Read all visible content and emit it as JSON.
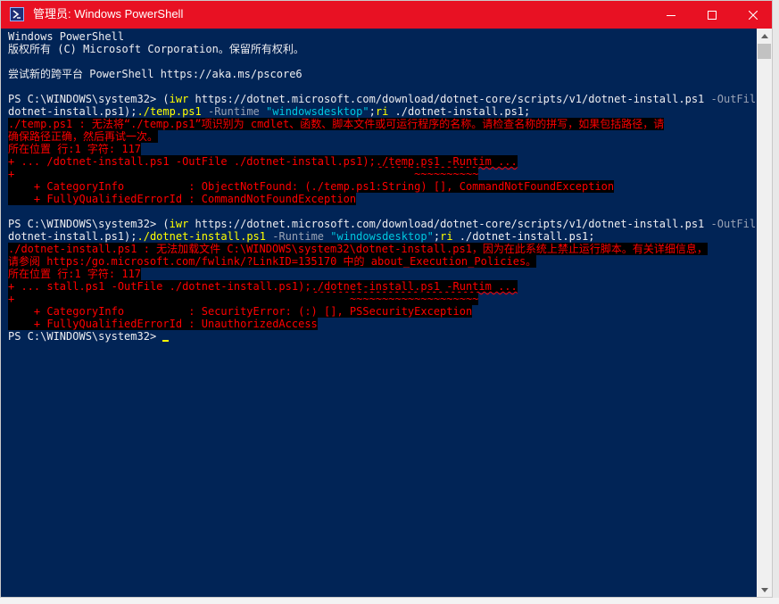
{
  "window": {
    "title": "管理员: Windows PowerShell",
    "title_bar_color": "#e81123",
    "background_color": "#012456",
    "icons": {
      "app": "powershell-icon",
      "minimize": "minimize-icon",
      "maximize": "maximize-icon",
      "close": "close-icon"
    }
  },
  "terminal": {
    "lines": [
      [
        {
          "t": "Windows PowerShell",
          "c": "w"
        }
      ],
      [
        {
          "t": "版权所有 (C) Microsoft Corporation。保留所有权利。",
          "c": "w"
        }
      ],
      [
        {
          "t": "",
          "c": "w"
        }
      ],
      [
        {
          "t": "尝试新的跨平台 PowerShell https://aka.ms/pscore6",
          "c": "w"
        }
      ],
      [
        {
          "t": "",
          "c": "w"
        }
      ],
      [
        {
          "t": "PS C:\\WINDOWS\\system32> ",
          "c": "w"
        },
        {
          "t": "(",
          "c": "w"
        },
        {
          "t": "iwr",
          "c": "y"
        },
        {
          "t": " https://dotnet.microsoft.com/download/dotnet-core/scripts/v1/dotnet-install.ps1 ",
          "c": "w"
        },
        {
          "t": "-OutFile",
          "c": "g"
        },
        {
          "t": " ./",
          "c": "w"
        }
      ],
      [
        {
          "t": "dotnet-install.ps1);",
          "c": "w"
        },
        {
          "t": "./temp.ps1",
          "c": "y"
        },
        {
          "t": " ",
          "c": "w"
        },
        {
          "t": "-Runtime",
          "c": "g"
        },
        {
          "t": " ",
          "c": "w"
        },
        {
          "t": "\"windowsdesktop\"",
          "c": "s"
        },
        {
          "t": ";",
          "c": "w"
        },
        {
          "t": "ri",
          "c": "y"
        },
        {
          "t": " ./dotnet-install.ps1;",
          "c": "w"
        }
      ],
      [
        {
          "t": "./temp.ps1 : 无法将“./temp.ps1”项识别为 cmdlet、函数、脚本文件或可运行程序的名称。请检查名称的拼写，如果包括路径，请",
          "c": "err"
        }
      ],
      [
        {
          "t": "确保路径正确，然后再试一次。",
          "c": "err"
        }
      ],
      [
        {
          "t": "所在位置 行:1 字符: 117",
          "c": "err"
        }
      ],
      [
        {
          "t": "+ ... /dotnet-install.ps1 -OutFile ./dotnet-install.ps1);",
          "c": "err"
        },
        {
          "t": "./temp.ps1 -Runtim ...",
          "c": "err",
          "sq": true
        }
      ],
      [
        {
          "t": "+                                                              ~~~~~~~~~~",
          "c": "err"
        }
      ],
      [
        {
          "t": "    + CategoryInfo          : ObjectNotFound: (./temp.ps1:String) [], CommandNotFoundException",
          "c": "err"
        }
      ],
      [
        {
          "t": "    + FullyQualifiedErrorId : CommandNotFoundException",
          "c": "err"
        }
      ],
      [
        {
          "t": "",
          "c": "w"
        }
      ],
      [
        {
          "t": "PS C:\\WINDOWS\\system32> ",
          "c": "w"
        },
        {
          "t": "(",
          "c": "w"
        },
        {
          "t": "iwr",
          "c": "y"
        },
        {
          "t": " https://dotnet.microsoft.com/download/dotnet-core/scripts/v1/dotnet-install.ps1 ",
          "c": "w"
        },
        {
          "t": "-OutFile",
          "c": "g"
        },
        {
          "t": " ./",
          "c": "w"
        }
      ],
      [
        {
          "t": "dotnet-install.ps1);",
          "c": "w"
        },
        {
          "t": "./dotnet-install.ps1",
          "c": "y"
        },
        {
          "t": " ",
          "c": "w"
        },
        {
          "t": "-Runtime",
          "c": "g"
        },
        {
          "t": " ",
          "c": "w"
        },
        {
          "t": "\"windowsdesktop\"",
          "c": "s"
        },
        {
          "t": ";",
          "c": "w"
        },
        {
          "t": "ri",
          "c": "y"
        },
        {
          "t": " ./dotnet-install.ps1;",
          "c": "w"
        }
      ],
      [
        {
          "t": "./dotnet-install.ps1 : 无法加载文件 C:\\WINDOWS\\system32\\dotnet-install.ps1，因为在此系统上禁止运行脚本。有关详细信息，",
          "c": "err"
        }
      ],
      [
        {
          "t": "请参阅 https:/go.microsoft.com/fwlink/?LinkID=135170 中的 about_Execution_Policies。",
          "c": "err"
        }
      ],
      [
        {
          "t": "所在位置 行:1 字符: 117",
          "c": "err"
        }
      ],
      [
        {
          "t": "+ ... stall.ps1 -OutFile ./dotnet-install.ps1);",
          "c": "err"
        },
        {
          "t": "./dotnet-install.ps1 -Runtim ...",
          "c": "err",
          "sq": true
        }
      ],
      [
        {
          "t": "+                                                    ~~~~~~~~~~~~~~~~~~~~",
          "c": "err"
        }
      ],
      [
        {
          "t": "    + CategoryInfo          : SecurityError: (:) [], PSSecurityException",
          "c": "err"
        }
      ],
      [
        {
          "t": "    + FullyQualifiedErrorId : UnauthorizedAccess",
          "c": "err"
        }
      ],
      [
        {
          "t": "PS C:\\WINDOWS\\system32> ",
          "c": "w"
        }
      ]
    ]
  },
  "scrollbar": {
    "up_icon": "scroll-up-arrow-icon",
    "down_icon": "scroll-down-arrow-icon"
  }
}
